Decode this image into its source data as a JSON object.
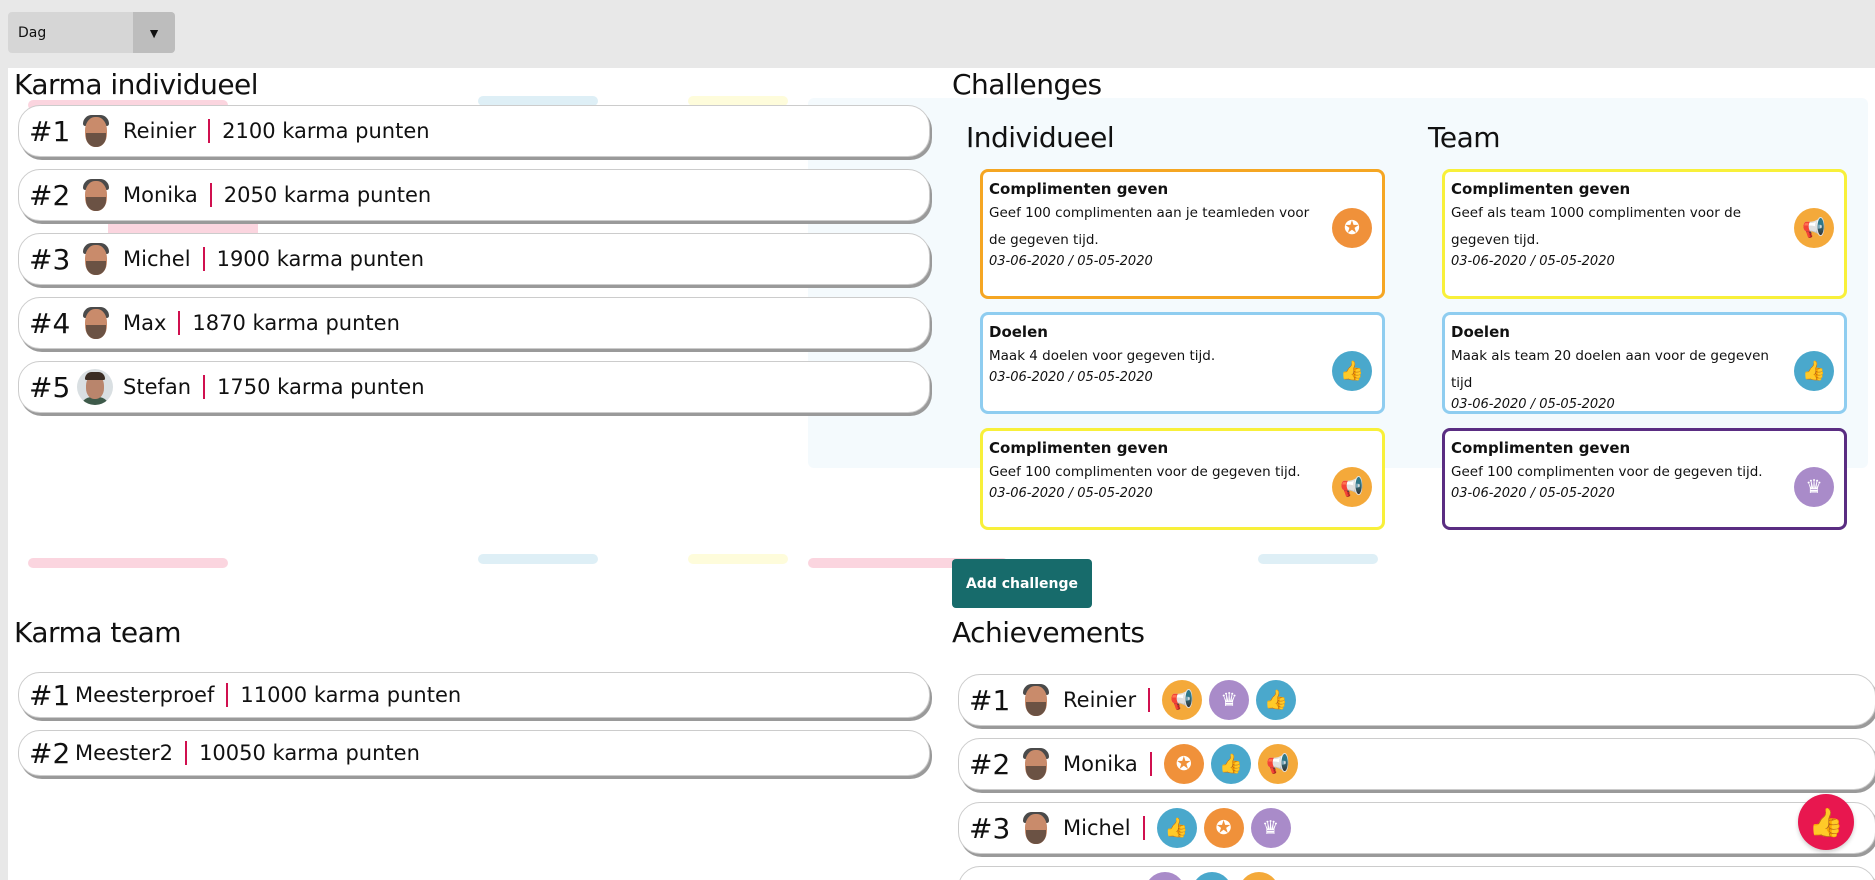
{
  "filter": {
    "selected": "Dag"
  },
  "karma_individual": {
    "title": "Karma individueel",
    "rows": [
      {
        "rank": "#1",
        "name": "Reinier",
        "points": "2100 karma punten"
      },
      {
        "rank": "#2",
        "name": "Monika",
        "points": "2050 karma punten"
      },
      {
        "rank": "#3",
        "name": "Michel",
        "points": "1900 karma punten"
      },
      {
        "rank": "#4",
        "name": "Max",
        "points": "1870 karma punten"
      },
      {
        "rank": "#5",
        "name": "Stefan",
        "points": "1750 karma punten"
      }
    ]
  },
  "karma_team": {
    "title": "Karma team",
    "rows": [
      {
        "rank": "#1",
        "name": "Meesterproef",
        "points": "11000 karma punten"
      },
      {
        "rank": "#2",
        "name": "Meester2",
        "points": "10050 karma punten"
      }
    ]
  },
  "challenges": {
    "title": "Challenges",
    "individual_title": "Individueel",
    "team_title": "Team",
    "individual": [
      {
        "title": "Complimenten geven",
        "desc": "Geef 100 complimenten aan je teamleden voor de gegeven tijd.",
        "dates": "03-06-2020 / 05-05-2020",
        "color": "#f5a623",
        "icon": "medal-icon",
        "icon_color": "#f0913a"
      },
      {
        "title": "Doelen",
        "desc": "Maak 4 doelen voor gegeven tijd.",
        "dates": "03-06-2020 / 05-05-2020",
        "color": "#8fcdf0",
        "icon": "thumbs-up-icon",
        "icon_color": "#4aa8cc"
      },
      {
        "title": "Complimenten geven",
        "desc": "Geef 100 complimenten voor de gegeven tijd.",
        "dates": "03-06-2020 / 05-05-2020",
        "color": "#f8f03a",
        "icon": "megaphone-icon",
        "icon_color": "#f4a93a"
      }
    ],
    "team": [
      {
        "title": "Complimenten geven",
        "desc": "Geef als team 1000 complimenten voor de gegeven tijd.",
        "dates": "03-06-2020 / 05-05-2020",
        "color": "#f8f03a",
        "icon": "megaphone-icon",
        "icon_color": "#f4a93a"
      },
      {
        "title": "Doelen",
        "desc": "Maak als team 20 doelen aan voor de gegeven tijd",
        "dates": "03-06-2020 / 05-05-2020",
        "color": "#8fcdf0",
        "icon": "thumbs-up-icon",
        "icon_color": "#4aa8cc"
      },
      {
        "title": "Complimenten geven",
        "desc": "Geef 100 complimenten voor de gegeven tijd.",
        "dates": "03-06-2020 / 05-05-2020",
        "color": "#5a2d82",
        "icon": "crown-icon",
        "icon_color": "#a98bc9"
      }
    ],
    "add_button": "Add challenge"
  },
  "achievements": {
    "title": "Achievements",
    "rows": [
      {
        "rank": "#1",
        "name": "Reinier",
        "badges": [
          "megaphone-icon",
          "crown-icon",
          "thumbs-up-icon"
        ]
      },
      {
        "rank": "#2",
        "name": "Monika",
        "badges": [
          "medal-icon",
          "thumbs-up-icon",
          "megaphone-icon"
        ]
      },
      {
        "rank": "#3",
        "name": "Michel",
        "badges": [
          "thumbs-up-icon",
          "medal-icon",
          "crown-icon"
        ]
      }
    ]
  },
  "badge_colors": {
    "megaphone-icon": "#f4a93a",
    "crown-icon": "#a98bc9",
    "thumbs-up-icon": "#4aa8cc",
    "medal-icon": "#f0913a"
  },
  "badge_glyphs": {
    "megaphone-icon": "📢",
    "crown-icon": "♛",
    "thumbs-up-icon": "👍",
    "medal-icon": "✪"
  },
  "fab_icon": "thumbs-up-icon"
}
